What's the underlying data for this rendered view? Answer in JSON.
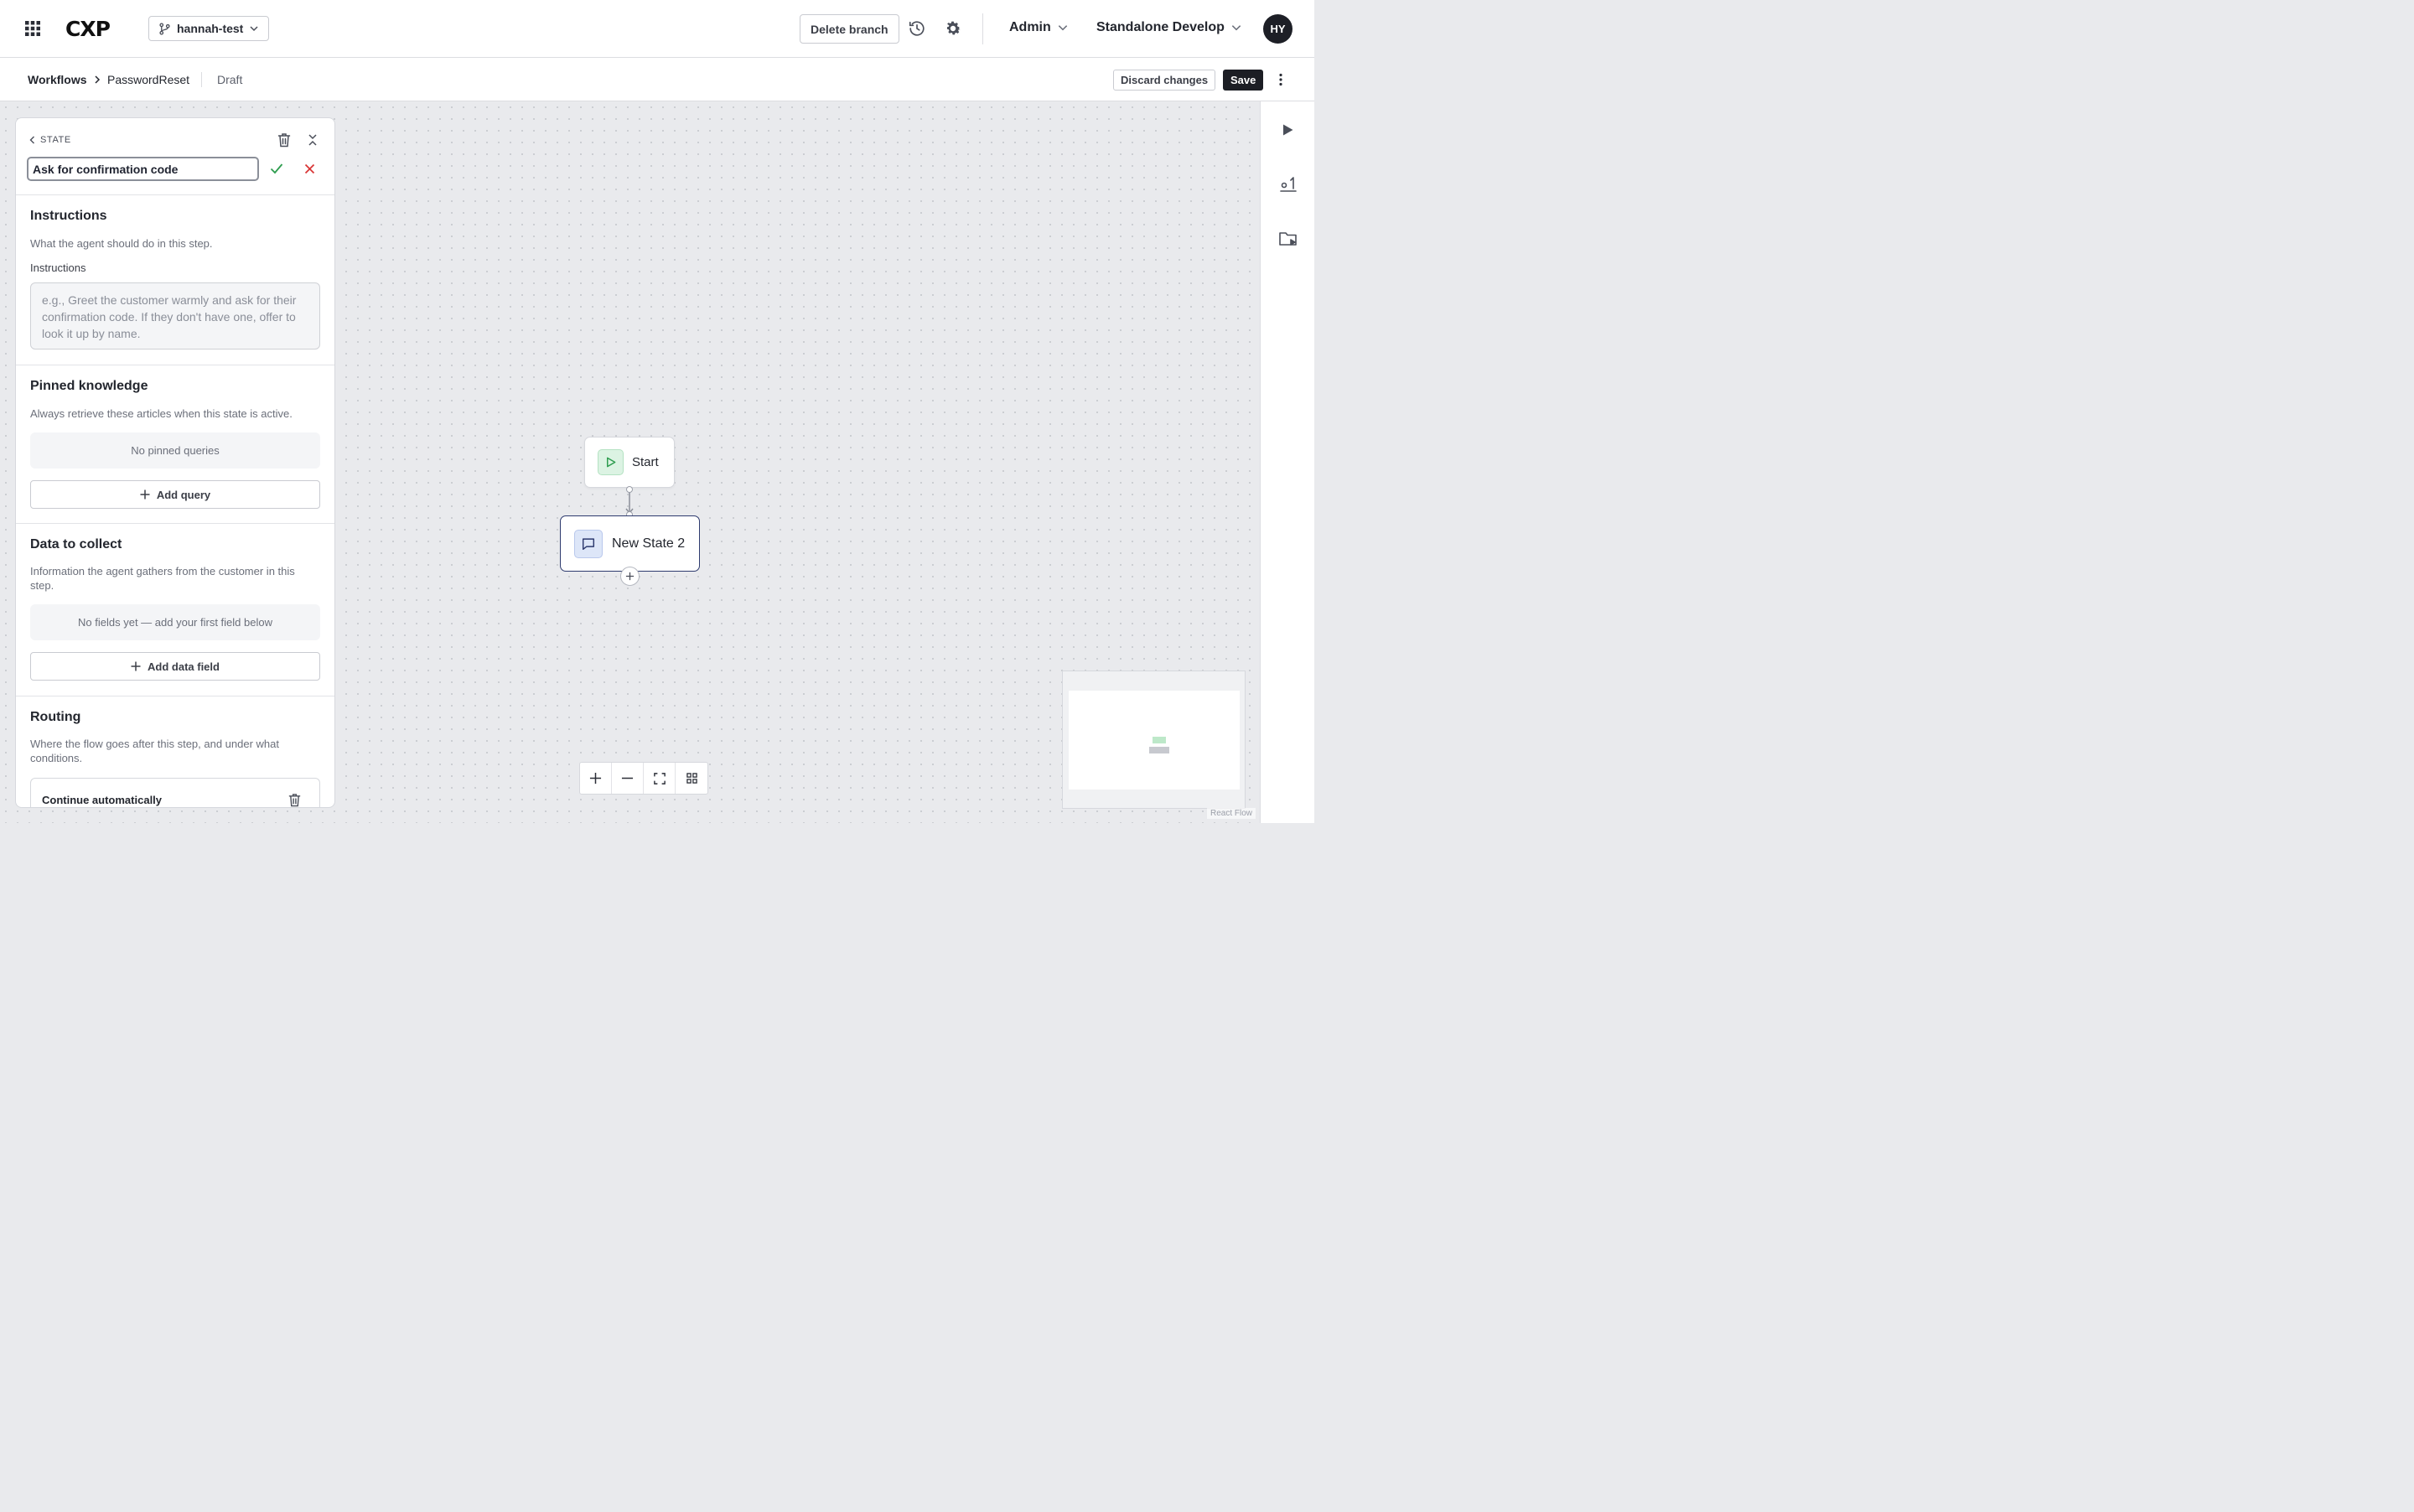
{
  "topbar": {
    "logo": "CXP",
    "branch": "hannah-test",
    "delete_branch": "Delete branch",
    "role": "Admin",
    "environment": "Standalone Develop",
    "avatar_initials": "HY"
  },
  "subbar": {
    "breadcrumb_root": "Workflows",
    "breadcrumb_current": "PasswordReset",
    "status": "Draft",
    "discard": "Discard changes",
    "save": "Save"
  },
  "panel": {
    "back_label": "STATE",
    "state_name": "Ask for confirmation code",
    "instructions": {
      "title": "Instructions",
      "description": "What the agent should do in this step.",
      "field_label": "Instructions",
      "placeholder": "e.g., Greet the customer warmly and ask for their confirmation code. If they don't have one, offer to look it up by name."
    },
    "pinned": {
      "title": "Pinned knowledge",
      "description": "Always retrieve these articles when this state is active.",
      "empty": "No pinned queries",
      "add": "Add query"
    },
    "data": {
      "title": "Data to collect",
      "description": "Information the agent gathers from the customer in this step.",
      "empty": "No fields yet — add your first field below",
      "add": "Add data field"
    },
    "routing": {
      "title": "Routing",
      "description": "Where the flow goes after this step, and under what conditions.",
      "rule": "Continue automatically"
    }
  },
  "canvas": {
    "start_node": "Start",
    "state_node": "New State 2",
    "attribution": "React Flow"
  },
  "colors": {
    "accent_dark": "#1c1e24",
    "node_border_selected": "#2d3a6e",
    "start_icon_bg": "#dcf3e3",
    "state_icon_bg": "#dde6f8",
    "confirm": "#2e9d4f",
    "cancel": "#d93636"
  }
}
